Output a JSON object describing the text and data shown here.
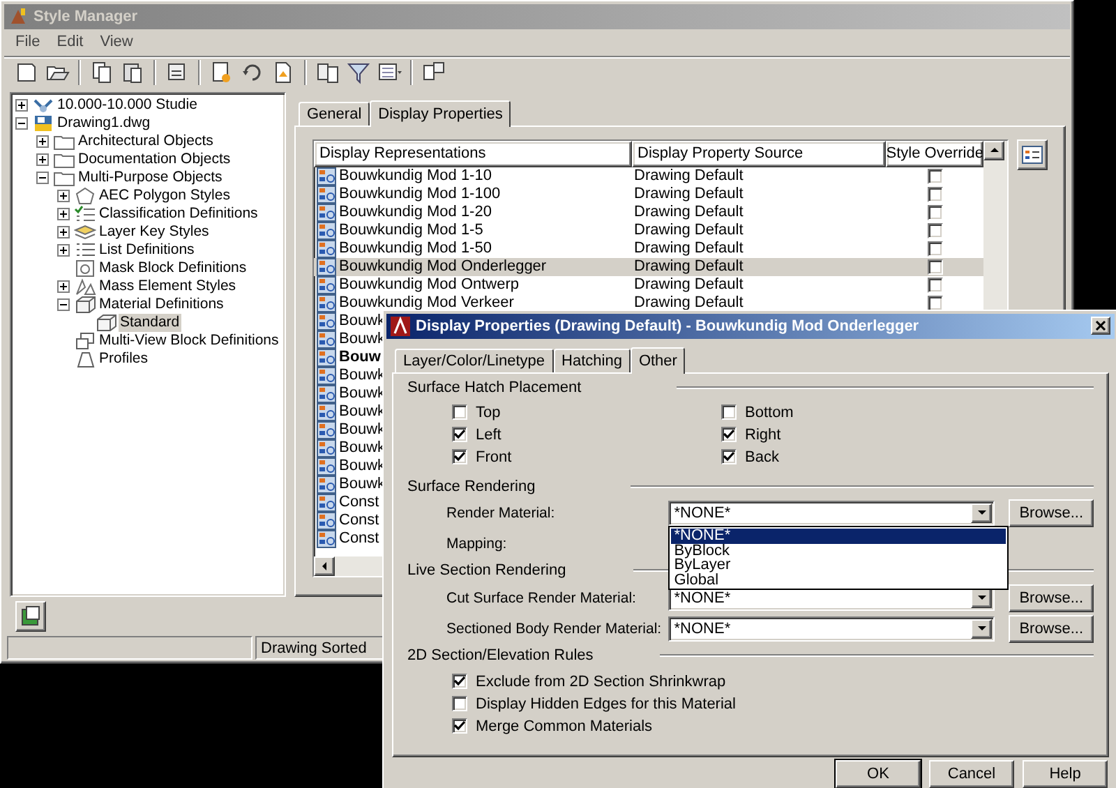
{
  "style_manager": {
    "title": "Style Manager",
    "menu": [
      "File",
      "Edit",
      "View"
    ],
    "tree": [
      {
        "label": "10.000-10.000 Studie",
        "kind": "project",
        "expanded": false,
        "selected": false
      },
      {
        "label": "Drawing1.dwg",
        "kind": "drawing",
        "expanded": true,
        "selected": false,
        "children": [
          {
            "label": "Architectural Objects",
            "kind": "folder",
            "expanded": false,
            "selected": false
          },
          {
            "label": "Documentation Objects",
            "kind": "folder",
            "expanded": false,
            "selected": false
          },
          {
            "label": "Multi-Purpose Objects",
            "kind": "folder",
            "expanded": true,
            "selected": false,
            "children": [
              {
                "label": "AEC Polygon Styles",
                "kind": "polygon",
                "expanded": false,
                "selected": false
              },
              {
                "label": "Classification Definitions",
                "kind": "classification",
                "expanded": false,
                "selected": false
              },
              {
                "label": "Layer Key Styles",
                "kind": "layerkey",
                "expanded": false,
                "selected": false
              },
              {
                "label": "List Definitions",
                "kind": "list",
                "expanded": false,
                "selected": false
              },
              {
                "label": "Mask Block Definitions",
                "kind": "mask",
                "selected": false
              },
              {
                "label": "Mass Element Styles",
                "kind": "mass",
                "expanded": false,
                "selected": false
              },
              {
                "label": "Material Definitions",
                "kind": "material",
                "expanded": true,
                "selected": false,
                "children": [
                  {
                    "label": "Standard",
                    "kind": "material",
                    "selected": true
                  }
                ]
              },
              {
                "label": "Multi-View Block Definitions",
                "kind": "multiview",
                "selected": false
              },
              {
                "label": "Profiles",
                "kind": "profile",
                "selected": false
              }
            ]
          }
        ]
      }
    ],
    "tabs": [
      {
        "label": "General",
        "selected": false
      },
      {
        "label": "Display Properties",
        "selected": true
      }
    ],
    "table": {
      "columns": [
        "Display Representations",
        "Display Property Source",
        "Style Override"
      ],
      "rows": [
        {
          "name": "Bouwkundig Mod 1-10",
          "source": "Drawing Default",
          "override": false,
          "selected": false,
          "emphasized": false
        },
        {
          "name": "Bouwkundig Mod 1-100",
          "source": "Drawing Default",
          "override": false,
          "selected": false,
          "emphasized": false
        },
        {
          "name": "Bouwkundig Mod 1-20",
          "source": "Drawing Default",
          "override": false,
          "selected": false,
          "emphasized": false
        },
        {
          "name": "Bouwkundig Mod 1-5",
          "source": "Drawing Default",
          "override": false,
          "selected": false,
          "emphasized": false
        },
        {
          "name": "Bouwkundig Mod 1-50",
          "source": "Drawing Default",
          "override": false,
          "selected": false,
          "emphasized": false
        },
        {
          "name": "Bouwkundig Mod Onderlegger",
          "source": "Drawing Default",
          "override": false,
          "selected": true,
          "emphasized": false
        },
        {
          "name": "Bouwkundig Mod Ontwerp",
          "source": "Drawing Default",
          "override": false,
          "selected": false,
          "emphasized": false
        },
        {
          "name": "Bouwkundig Mod Verkeer",
          "source": "Drawing Default",
          "override": false,
          "selected": false,
          "emphasized": false
        },
        {
          "name": "Bouwk",
          "selected": false,
          "emphasized": false
        },
        {
          "name": "Bouwk",
          "selected": false,
          "emphasized": false
        },
        {
          "name": "Bouw",
          "selected": false,
          "emphasized": true
        },
        {
          "name": "Bouwk",
          "selected": false,
          "emphasized": false
        },
        {
          "name": "Bouwk",
          "selected": false,
          "emphasized": false
        },
        {
          "name": "Bouwk",
          "selected": false,
          "emphasized": false
        },
        {
          "name": "Bouwk",
          "selected": false,
          "emphasized": false
        },
        {
          "name": "Bouwk",
          "selected": false,
          "emphasized": false
        },
        {
          "name": "Bouwk",
          "selected": false,
          "emphasized": false
        },
        {
          "name": "Bouwk",
          "selected": false,
          "emphasized": false
        },
        {
          "name": "Const",
          "selected": false,
          "emphasized": false
        },
        {
          "name": "Const",
          "selected": false,
          "emphasized": false
        },
        {
          "name": "Const",
          "selected": false,
          "emphasized": false
        }
      ]
    },
    "status_bar": "Drawing Sorted"
  },
  "dialog": {
    "title": "Display Properties (Drawing Default) - Bouwkundig Mod Onderlegger",
    "tabs": [
      {
        "label": "Layer/Color/Linetype",
        "selected": false
      },
      {
        "label": "Hatching",
        "selected": false
      },
      {
        "label": "Other",
        "selected": true
      }
    ],
    "surface_hatch": {
      "heading": "Surface Hatch Placement",
      "options": [
        {
          "label": "Top",
          "checked": false
        },
        {
          "label": "Bottom",
          "checked": false
        },
        {
          "label": "Left",
          "checked": true
        },
        {
          "label": "Right",
          "checked": true
        },
        {
          "label": "Front",
          "checked": true
        },
        {
          "label": "Back",
          "checked": true
        }
      ]
    },
    "surface_rendering": {
      "heading": "Surface Rendering",
      "render_material": {
        "label": "Render Material:",
        "value": "*NONE*",
        "button": "Browse...",
        "open": true,
        "options": [
          {
            "label": "*NONE*",
            "selected": true
          },
          {
            "label": "ByBlock",
            "selected": false
          },
          {
            "label": "ByLayer",
            "selected": false
          },
          {
            "label": "Global",
            "selected": false
          }
        ]
      },
      "mapping": {
        "label": "Mapping:"
      }
    },
    "live_section": {
      "heading": "Live Section Rendering",
      "fields": [
        {
          "label": "Cut Surface Render Material:",
          "value": "*NONE*",
          "button": "Browse..."
        },
        {
          "label": "Sectioned Body Render Material:",
          "value": "*NONE*",
          "button": "Browse..."
        }
      ]
    },
    "rules": {
      "heading": "2D Section/Elevation Rules",
      "options": [
        {
          "label": "Exclude from 2D Section Shrinkwrap",
          "checked": true
        },
        {
          "label": "Display Hidden Edges for this Material",
          "checked": false
        },
        {
          "label": "Merge Common Materials",
          "checked": true
        }
      ]
    },
    "buttons": [
      "OK",
      "Cancel",
      "Help"
    ]
  }
}
